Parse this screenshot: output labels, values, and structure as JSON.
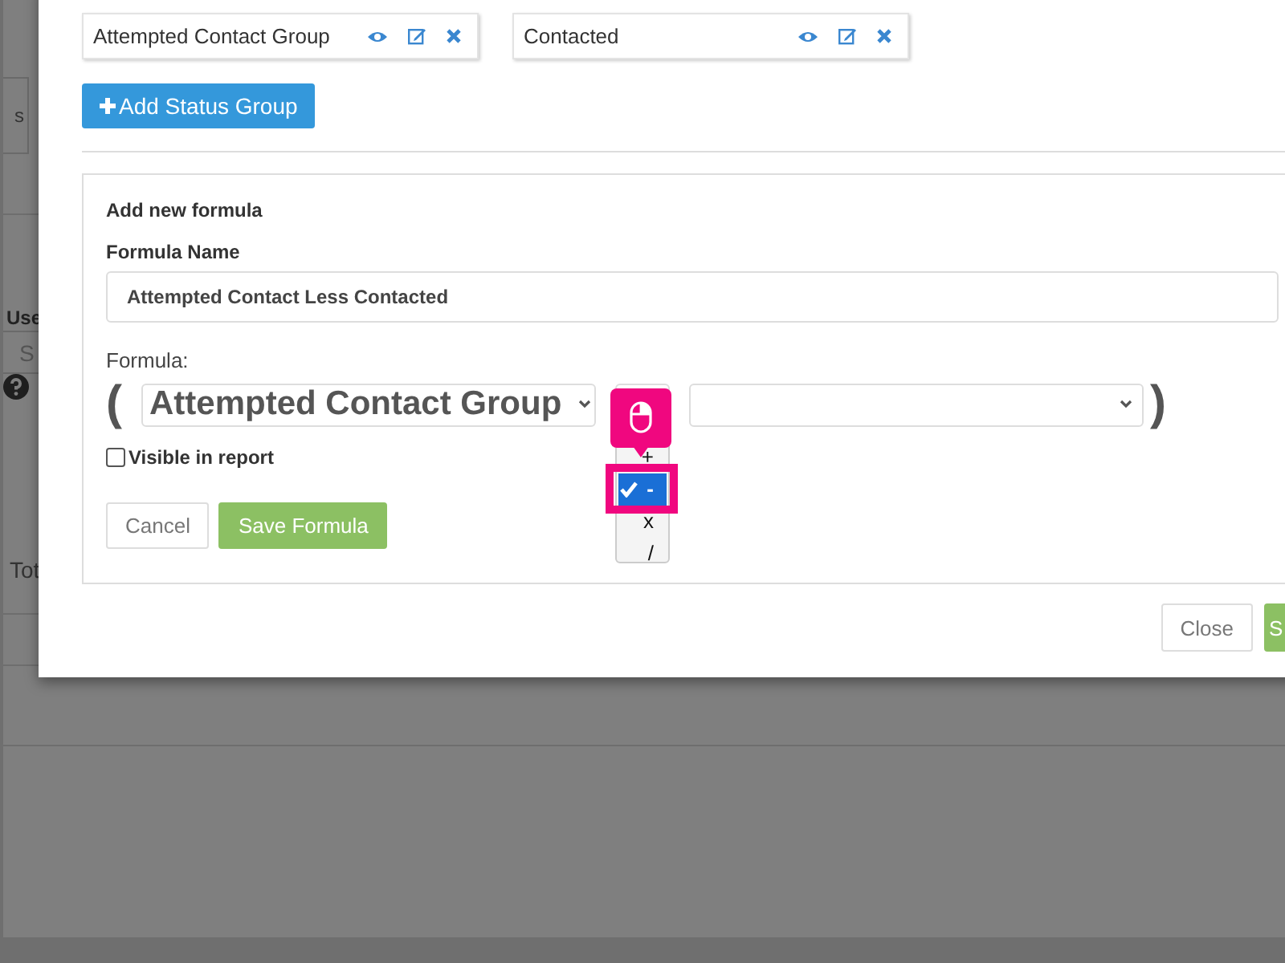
{
  "background": {
    "tab": "s",
    "user_label": "Use",
    "search_placeholder": "S",
    "total_label": "Tot"
  },
  "status_groups": [
    {
      "name": "Attempted Contact Group"
    },
    {
      "name": "Contacted"
    }
  ],
  "add_button": "Add Status Group",
  "formula_form": {
    "title": "Add new formula",
    "name_label": "Formula Name",
    "name_value": "Attempted Contact Less Contacted",
    "formula_label": "Formula:",
    "open_paren": "(",
    "left_operand": "Attempted Contact Group",
    "operator_options": [
      {
        "label": "+",
        "selected": false
      },
      {
        "label": "-",
        "selected": true
      },
      {
        "label": "x",
        "selected": false
      },
      {
        "label": "/",
        "selected": false
      }
    ],
    "close_paren": ")",
    "visible_in_report": {
      "label": "Visible in report",
      "checked": false
    },
    "buttons": [
      {
        "label": "Cancel",
        "kind": "default"
      },
      {
        "label": "Save Formula",
        "kind": "primary"
      }
    ]
  },
  "footer_buttons": [
    {
      "label": "Close",
      "kind": "default"
    },
    {
      "label": "S",
      "kind": "primary"
    }
  ]
}
